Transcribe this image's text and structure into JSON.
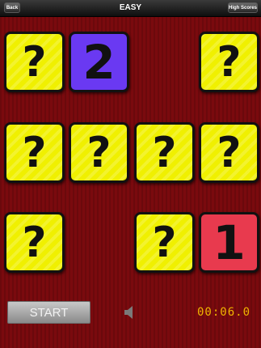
{
  "header": {
    "back_label": "Back",
    "title": "EASY",
    "high_scores_label": "High Scores"
  },
  "board": {
    "cards": [
      {
        "row": 1,
        "col": 1,
        "state": "hidden",
        "text": "?"
      },
      {
        "row": 1,
        "col": 2,
        "state": "revealed",
        "text": "2",
        "color": "#6a39f2"
      },
      {
        "row": 1,
        "col": 4,
        "state": "hidden",
        "text": "?"
      },
      {
        "row": 2,
        "col": 1,
        "state": "hidden",
        "text": "?"
      },
      {
        "row": 2,
        "col": 2,
        "state": "hidden",
        "text": "?"
      },
      {
        "row": 2,
        "col": 3,
        "state": "hidden",
        "text": "?"
      },
      {
        "row": 2,
        "col": 4,
        "state": "hidden",
        "text": "?"
      },
      {
        "row": 3,
        "col": 1,
        "state": "hidden",
        "text": "?"
      },
      {
        "row": 3,
        "col": 3,
        "state": "hidden",
        "text": "?"
      },
      {
        "row": 3,
        "col": 4,
        "state": "revealed",
        "text": "1",
        "color": "#e83a4e"
      }
    ],
    "hidden_color": "#f0f000"
  },
  "controls": {
    "start_label": "START",
    "sound_icon": "speaker-icon",
    "timer": "00:06.0"
  },
  "colors": {
    "background": "#7a0a0e",
    "timer": "#f0b400"
  }
}
